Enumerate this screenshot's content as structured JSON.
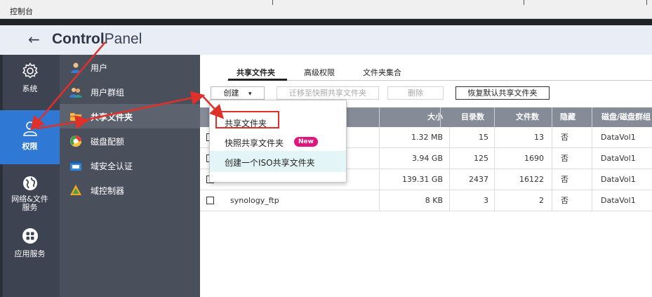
{
  "window": {
    "title": "控制台"
  },
  "header": {
    "back_icon": "arrow-left-icon",
    "title_bold": "Control",
    "title_light": "Panel"
  },
  "leftnav": {
    "items": [
      {
        "label": "系统",
        "icon": "gear-icon"
      },
      {
        "label": "权限",
        "icon": "user-icon",
        "active": true
      },
      {
        "label": "网络&文件服务",
        "line1": "网络&文件",
        "line2": "服务",
        "icon": "globe-icon"
      },
      {
        "label": "应用服务",
        "icon": "apps-grid-icon"
      }
    ]
  },
  "subnav": {
    "items": [
      {
        "label": "用户",
        "icon": "user-icon"
      },
      {
        "label": "用户群组",
        "icon": "user-group-icon"
      },
      {
        "label": "共享文件夹",
        "icon": "shared-folder-icon",
        "active": true
      },
      {
        "label": "磁盘配额",
        "icon": "disk-quota-icon"
      },
      {
        "label": "域安全认证",
        "icon": "domain-security-icon"
      },
      {
        "label": "域控制器",
        "icon": "domain-controller-icon"
      }
    ]
  },
  "tabs": [
    {
      "label": "共享文件夹",
      "active": true
    },
    {
      "label": "高级权限"
    },
    {
      "label": "文件夹集合"
    }
  ],
  "toolbar": {
    "create_label": "创建",
    "create_caret": "▾",
    "migrate_label": "迁移至快照共享文件夹",
    "delete_label": "删除",
    "restore_label": "恢复默认共享文件夹"
  },
  "table": {
    "columns": [
      "大小",
      "目录数",
      "文件数",
      "隐藏",
      "磁盘/磁盘群组"
    ],
    "rows": [
      {
        "name": "",
        "size": "1.32 MB",
        "dirs": "15",
        "files": "13",
        "hidden": "否",
        "volume": "DataVol1"
      },
      {
        "name": "",
        "size": "3.94 GB",
        "dirs": "125",
        "files": "1690",
        "hidden": "否",
        "volume": "DataVol1"
      },
      {
        "name": "",
        "size": "139.31 GB",
        "dirs": "2437",
        "files": "16122",
        "hidden": "否",
        "volume": "DataVol1"
      },
      {
        "name": "synology_ftp",
        "size": "8 KB",
        "dirs": "3",
        "files": "2",
        "hidden": "否",
        "volume": "DataVol1"
      }
    ]
  },
  "dropdown": {
    "items": [
      {
        "label": "共享文件夹"
      },
      {
        "label": "快照共享文件夹",
        "badge": "New"
      },
      {
        "label": "创建一个ISO共享文件夹",
        "highlighted": true
      }
    ]
  },
  "colors": {
    "accent": "#2f78d3",
    "annotation": "#e0302a",
    "badge": "#e0157d",
    "nav_bg": "#3d4350",
    "table_header": "#858b97"
  }
}
